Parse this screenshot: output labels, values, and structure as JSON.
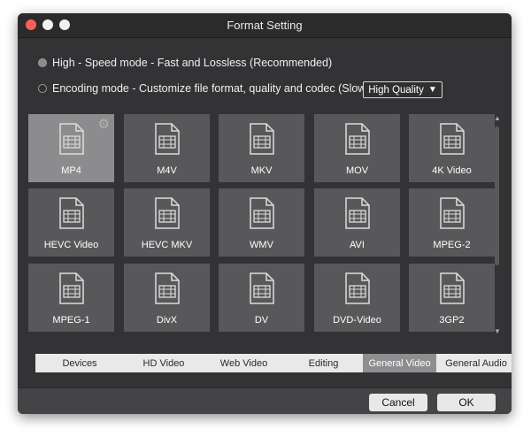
{
  "window": {
    "title": "Format Setting"
  },
  "modes": [
    {
      "label": "High - Speed mode - Fast and Lossless (Recommended)",
      "selected": true
    },
    {
      "label": "Encoding mode - Customize file format, quality and codec (Slow)",
      "selected": false
    }
  ],
  "quality": {
    "value": "High Quality",
    "caret": "▼"
  },
  "formats": [
    {
      "label": "MP4",
      "selected": true
    },
    {
      "label": "M4V"
    },
    {
      "label": "MKV"
    },
    {
      "label": "MOV"
    },
    {
      "label": "4K Video"
    },
    {
      "label": "HEVC Video"
    },
    {
      "label": "HEVC MKV"
    },
    {
      "label": "WMV"
    },
    {
      "label": "AVI"
    },
    {
      "label": "MPEG-2"
    },
    {
      "label": "MPEG-1"
    },
    {
      "label": "DivX"
    },
    {
      "label": "DV"
    },
    {
      "label": "DVD-Video"
    },
    {
      "label": "3GP2"
    }
  ],
  "tabs": [
    {
      "label": "Devices"
    },
    {
      "label": "HD Video"
    },
    {
      "label": "Web Video"
    },
    {
      "label": "Editing"
    },
    {
      "label": "General Video",
      "active": true
    },
    {
      "label": "General Audio"
    }
  ],
  "buttons": {
    "cancel": "Cancel",
    "ok": "OK"
  },
  "icons": {
    "gear": "⚙",
    "scroll_up": "▲",
    "scroll_down": "▼"
  }
}
